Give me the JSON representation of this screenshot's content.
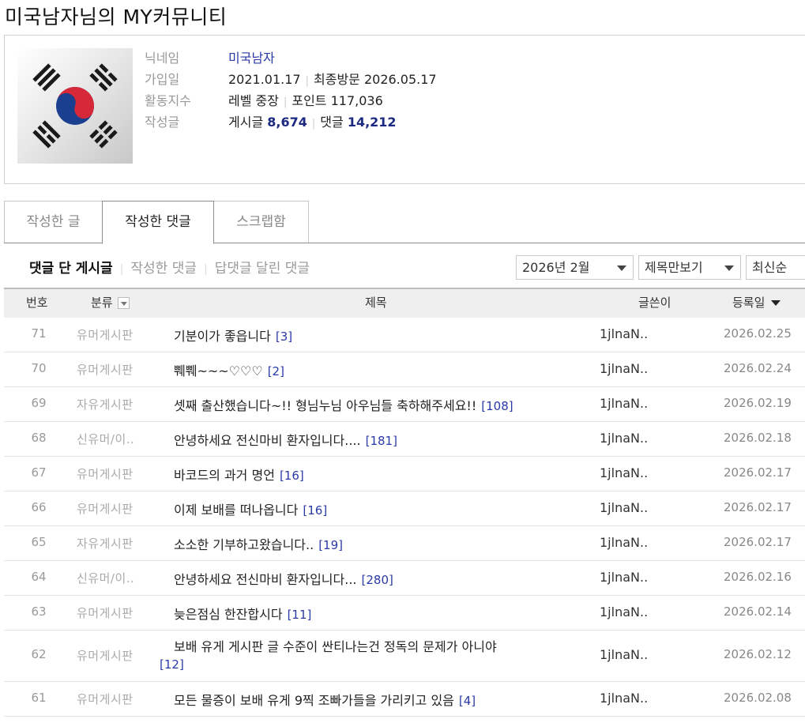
{
  "page_title": "미국남자님의 MY커뮤니티",
  "profile": {
    "nickname_label": "닉네임",
    "nickname": "미국남자",
    "join_label": "가입일",
    "join_date": "2021.01.17",
    "last_visit": "최종방문 2026.05.17",
    "activity_label": "활동지수",
    "level": "레벨 중장",
    "points": "포인트 117,036",
    "posts_label": "작성글",
    "post_text": "게시글",
    "post_count": "8,674",
    "comment_text": "댓글",
    "comment_count": "14,212"
  },
  "tabs": [
    {
      "label": "작성한 글",
      "active": false
    },
    {
      "label": "작성한 댓글",
      "active": true
    },
    {
      "label": "스크랩함",
      "active": false
    }
  ],
  "subnav": [
    {
      "label": "댓글 단 게시글",
      "active": true
    },
    {
      "label": "작성한 댓글",
      "active": false
    },
    {
      "label": "답댓글 달린 댓글",
      "active": false
    }
  ],
  "filters": {
    "month": "2026년 2월",
    "view": "제목만보기",
    "sort": "최신순"
  },
  "table": {
    "headers": {
      "num": "번호",
      "category": "분류",
      "title": "제목",
      "writer": "글쓴이",
      "date": "등록일"
    },
    "rows": [
      {
        "num": "71",
        "category": "유머게시판",
        "title": "기분이가 좋읍니다",
        "count": "[3]",
        "writer": "1jlnaN..",
        "date": "2026.02.25"
      },
      {
        "num": "70",
        "category": "유머게시판",
        "title": "쀄쀄~~~♡♡♡",
        "count": "[2]",
        "writer": "1jlnaN..",
        "date": "2026.02.24"
      },
      {
        "num": "69",
        "category": "자유게시판",
        "title": "셋째 출산했습니다~!! 형님누님 아우님들 축하해주세요!!",
        "count": "[108]",
        "writer": "1jlnaN..",
        "date": "2026.02.19"
      },
      {
        "num": "68",
        "category": "신유머/이..",
        "title": "안녕하세요 전신마비 환자입니다....",
        "count": "[181]",
        "writer": "1jlnaN..",
        "date": "2026.02.18"
      },
      {
        "num": "67",
        "category": "유머게시판",
        "title": "바코드의 과거 명언",
        "count": "[16]",
        "writer": "1jlnaN..",
        "date": "2026.02.17"
      },
      {
        "num": "66",
        "category": "유머게시판",
        "title": "이제 보배를 떠나옵니다",
        "count": "[16]",
        "writer": "1jlnaN..",
        "date": "2026.02.17"
      },
      {
        "num": "65",
        "category": "자유게시판",
        "title": "소소한 기부하고왔습니다..",
        "count": "[19]",
        "writer": "1jlnaN..",
        "date": "2026.02.17"
      },
      {
        "num": "64",
        "category": "신유머/이..",
        "title": "안녕하세요 전신마비 환자입니다...",
        "count": "[280]",
        "writer": "1jlnaN..",
        "date": "2026.02.16"
      },
      {
        "num": "63",
        "category": "유머게시판",
        "title": "늦은점심 한잔합시다",
        "count": "[11]",
        "writer": "1jlnaN..",
        "date": "2026.02.14"
      },
      {
        "num": "62",
        "category": "유머게시판",
        "title": "보배 유게 게시판 글 수준이 싼티나는건 정독의 문제가 아니야",
        "count": "[12]",
        "writer": "1jlnaN..",
        "date": "2026.02.12"
      },
      {
        "num": "61",
        "category": "유머게시판",
        "title": "모든 물증이 보배 유게 9찍 조빠가들을 가리키고 있음",
        "count": "[4]",
        "writer": "1jlnaN..",
        "date": "2026.02.08"
      }
    ]
  }
}
